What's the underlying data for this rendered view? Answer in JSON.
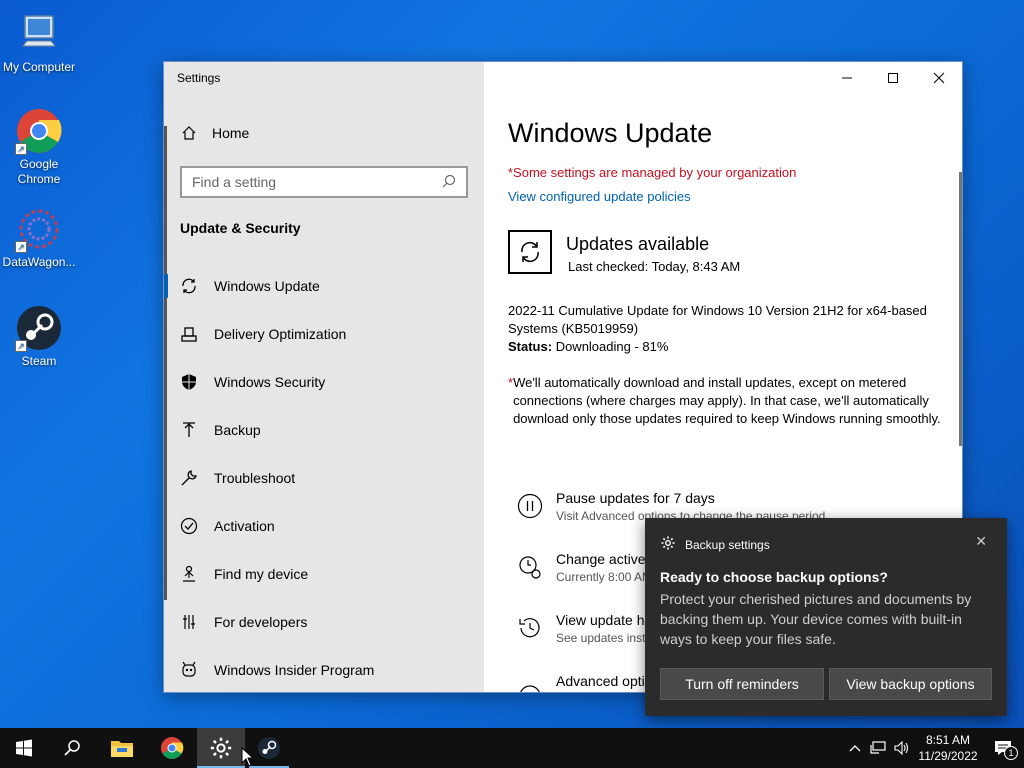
{
  "desktop": {
    "icons": [
      {
        "label": "My Computer"
      },
      {
        "label": "Google Chrome"
      },
      {
        "label": "DataWagon..."
      },
      {
        "label": "Steam"
      }
    ]
  },
  "window": {
    "title": "Settings",
    "controls": {
      "minimize": "minimize",
      "maximize": "maximize",
      "close": "close"
    }
  },
  "sidebar": {
    "home_label": "Home",
    "search_placeholder": "Find a setting",
    "section_title": "Update & Security",
    "items": [
      {
        "label": "Windows Update",
        "icon": "sync-icon",
        "active": true
      },
      {
        "label": "Delivery Optimization",
        "icon": "delivery-icon",
        "active": false
      },
      {
        "label": "Windows Security",
        "icon": "shield-icon",
        "active": false
      },
      {
        "label": "Backup",
        "icon": "backup-icon",
        "active": false
      },
      {
        "label": "Troubleshoot",
        "icon": "wrench-icon",
        "active": false
      },
      {
        "label": "Activation",
        "icon": "check-circle-icon",
        "active": false
      },
      {
        "label": "Find my device",
        "icon": "person-pin-icon",
        "active": false
      },
      {
        "label": "For developers",
        "icon": "developer-icon",
        "active": false
      },
      {
        "label": "Windows Insider Program",
        "icon": "insider-icon",
        "active": false
      }
    ]
  },
  "main": {
    "title": "Windows Update",
    "managed_notice": "*Some settings are managed by your organization",
    "policies_link": "View configured update policies",
    "status_heading": "Updates available",
    "last_checked": "Last checked: Today, 8:43 AM",
    "update_name": "2022-11 Cumulative Update for Windows 10 Version 21H2 for x64-based Systems (KB5019959)",
    "status_label": "Status:",
    "status_value": "Downloading - 81%",
    "note_star": "*",
    "note_text": "We'll automatically download and install updates, except on metered connections (where charges may apply). In that case, we'll automatically download only those updates required to keep Windows running smoothly.",
    "options": [
      {
        "title": "Pause updates for 7 days",
        "subtitle": "Visit Advanced options to change the pause period",
        "icon": "pause-icon"
      },
      {
        "title": "Change active hours",
        "subtitle": "Currently 8:00 AM to 5:00 PM",
        "icon": "clock-icon"
      },
      {
        "title": "View update history",
        "subtitle": "See updates installed on your device",
        "icon": "history-icon"
      },
      {
        "title": "Advanced options",
        "subtitle": "",
        "icon": "advanced-gear-icon"
      }
    ]
  },
  "toast": {
    "app_name": "Backup settings",
    "title": "Ready to choose backup options?",
    "body": "Protect your cherished pictures and documents by backing them up. Your device comes with built-in ways to keep your files safe.",
    "button_dismiss": "Turn off reminders",
    "button_action": "View backup options",
    "close": "✕"
  },
  "taskbar": {
    "time": "8:51 AM",
    "date": "11/29/2022",
    "notification_count": "1"
  },
  "colors": {
    "accent": "#0063b1",
    "warning": "#c50f1f",
    "toast_bg": "#2b2b2b",
    "taskbar_bg": "#101010"
  }
}
